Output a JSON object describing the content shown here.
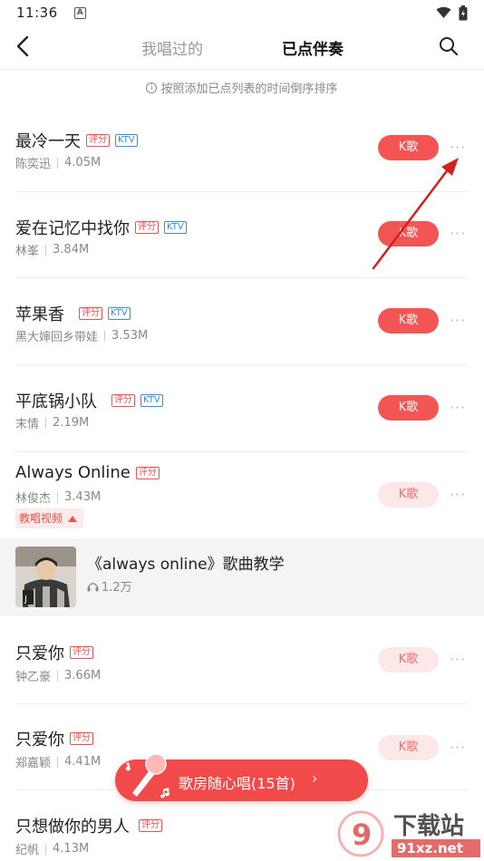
{
  "status": {
    "time": "11:36",
    "notif_icon": "A"
  },
  "header": {
    "tab_sung": "我唱过的",
    "tab_selected": "已点伴奏"
  },
  "hint": "按照添加已点列表的时间倒序排序",
  "songs": [
    {
      "title": "最冷一天",
      "score": "评分",
      "ktv": "KTV",
      "artist": "陈奕迅",
      "size": "4.05M",
      "button": "K歌"
    },
    {
      "title": "爱在记忆中找你",
      "score": "评分",
      "ktv": "KTV",
      "artist": "林峯",
      "size": "3.84M",
      "button": "K歌"
    },
    {
      "title": "苹果香",
      "score": "评分",
      "ktv": "KTV",
      "artist": "黑大婶回乡带娃",
      "size": "3.53M",
      "button": "K歌"
    },
    {
      "title": "平底锅小队",
      "score": "评分",
      "ktv": "KTV",
      "artist": "末情",
      "size": "2.19M",
      "button": "K歌"
    },
    {
      "title": "Always Online",
      "score": "评分",
      "artist": "林俊杰",
      "size": "3.43M",
      "button": "K歌",
      "tutorial": "教唱视频"
    },
    {
      "title": "只爱你",
      "score": "评分",
      "artist": "钟乙豪",
      "size": "3.66M",
      "button": "K歌"
    },
    {
      "title": "只爱你",
      "score": "评分",
      "artist": "郑嘉颖",
      "size": "4.41M",
      "button": "K歌"
    },
    {
      "title": "只想做你的男人",
      "score": "评分",
      "artist": "纪帆",
      "size": "4.13M",
      "button": "K歌"
    }
  ],
  "video": {
    "title": "《always online》歌曲教学",
    "plays": "1.2万"
  },
  "floating": {
    "label": "歌房随心唱(15首)",
    "chevron": "›"
  },
  "watermark": {
    "brand": "下载站",
    "domain": "91xz.net",
    "logo": "9"
  },
  "colors": {
    "accent": "#f35454",
    "ktv": "#2f8fe8",
    "annotation_arrow": "#d42020"
  }
}
